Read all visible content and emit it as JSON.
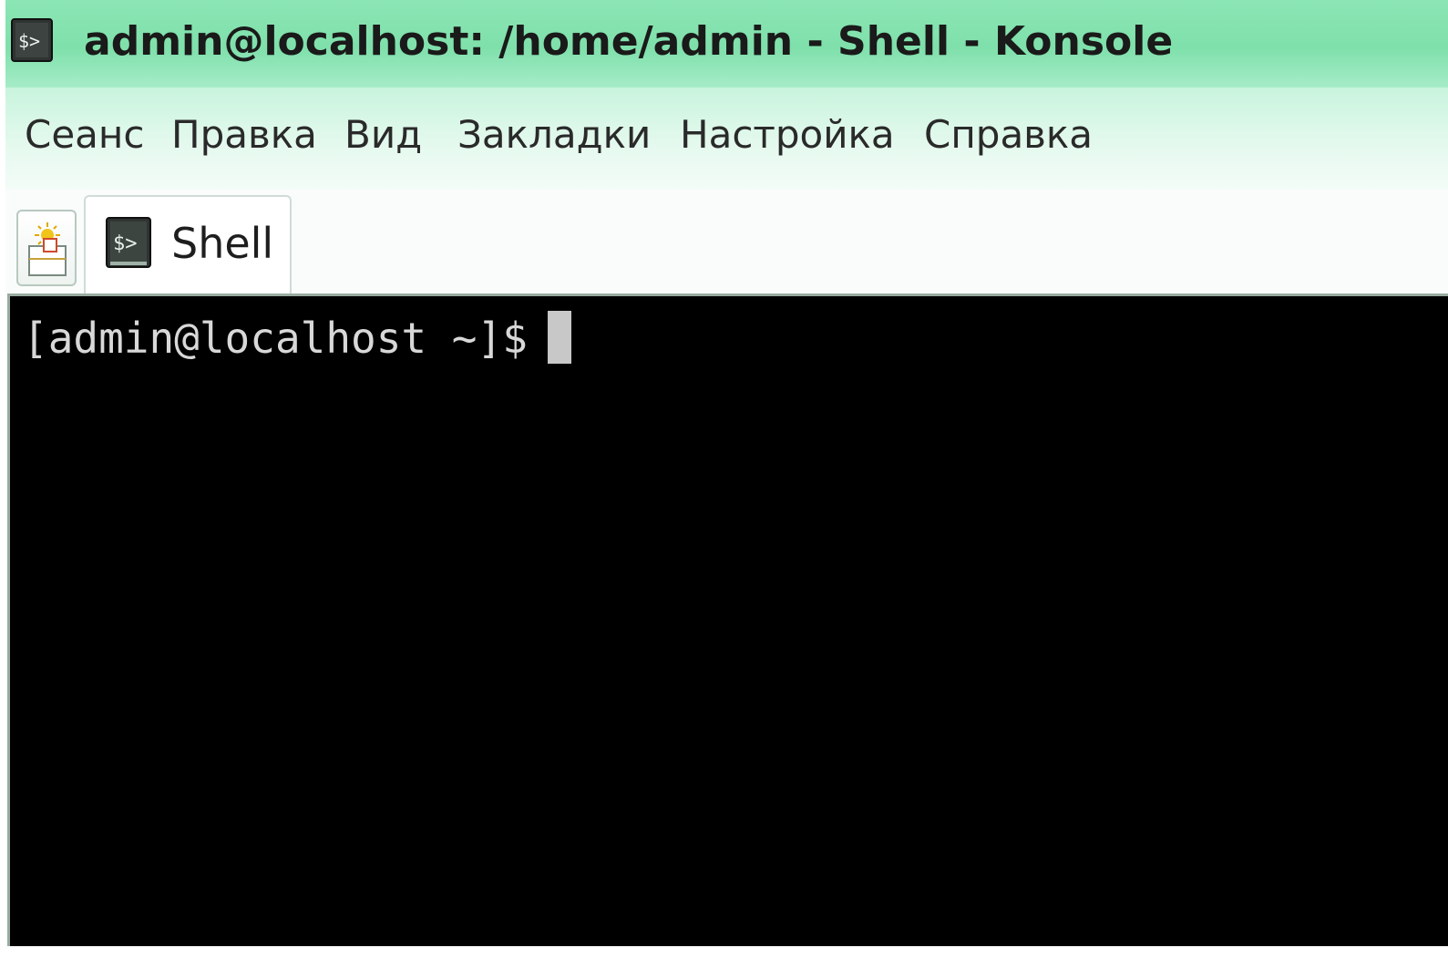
{
  "window": {
    "title": "admin@localhost: /home/admin - Shell - Konsole",
    "app_icon": "terminal-icon"
  },
  "menubar": {
    "items": [
      {
        "label": "Сеанс"
      },
      {
        "label": "Правка"
      },
      {
        "label": "Вид"
      },
      {
        "label": "Закладки"
      },
      {
        "label": "Настройка"
      },
      {
        "label": "Справка"
      }
    ]
  },
  "tabs": {
    "new_tab_icon": "new-tab-icon",
    "items": [
      {
        "label": "Shell",
        "icon": "terminal-icon",
        "active": true
      }
    ]
  },
  "terminal": {
    "prompt": "[admin@localhost ~]$"
  },
  "colors": {
    "titlebar": "#7fe0ab",
    "menubar": "#e4f9ee",
    "terminal_bg": "#000000",
    "terminal_fg": "#d8d8d8"
  }
}
